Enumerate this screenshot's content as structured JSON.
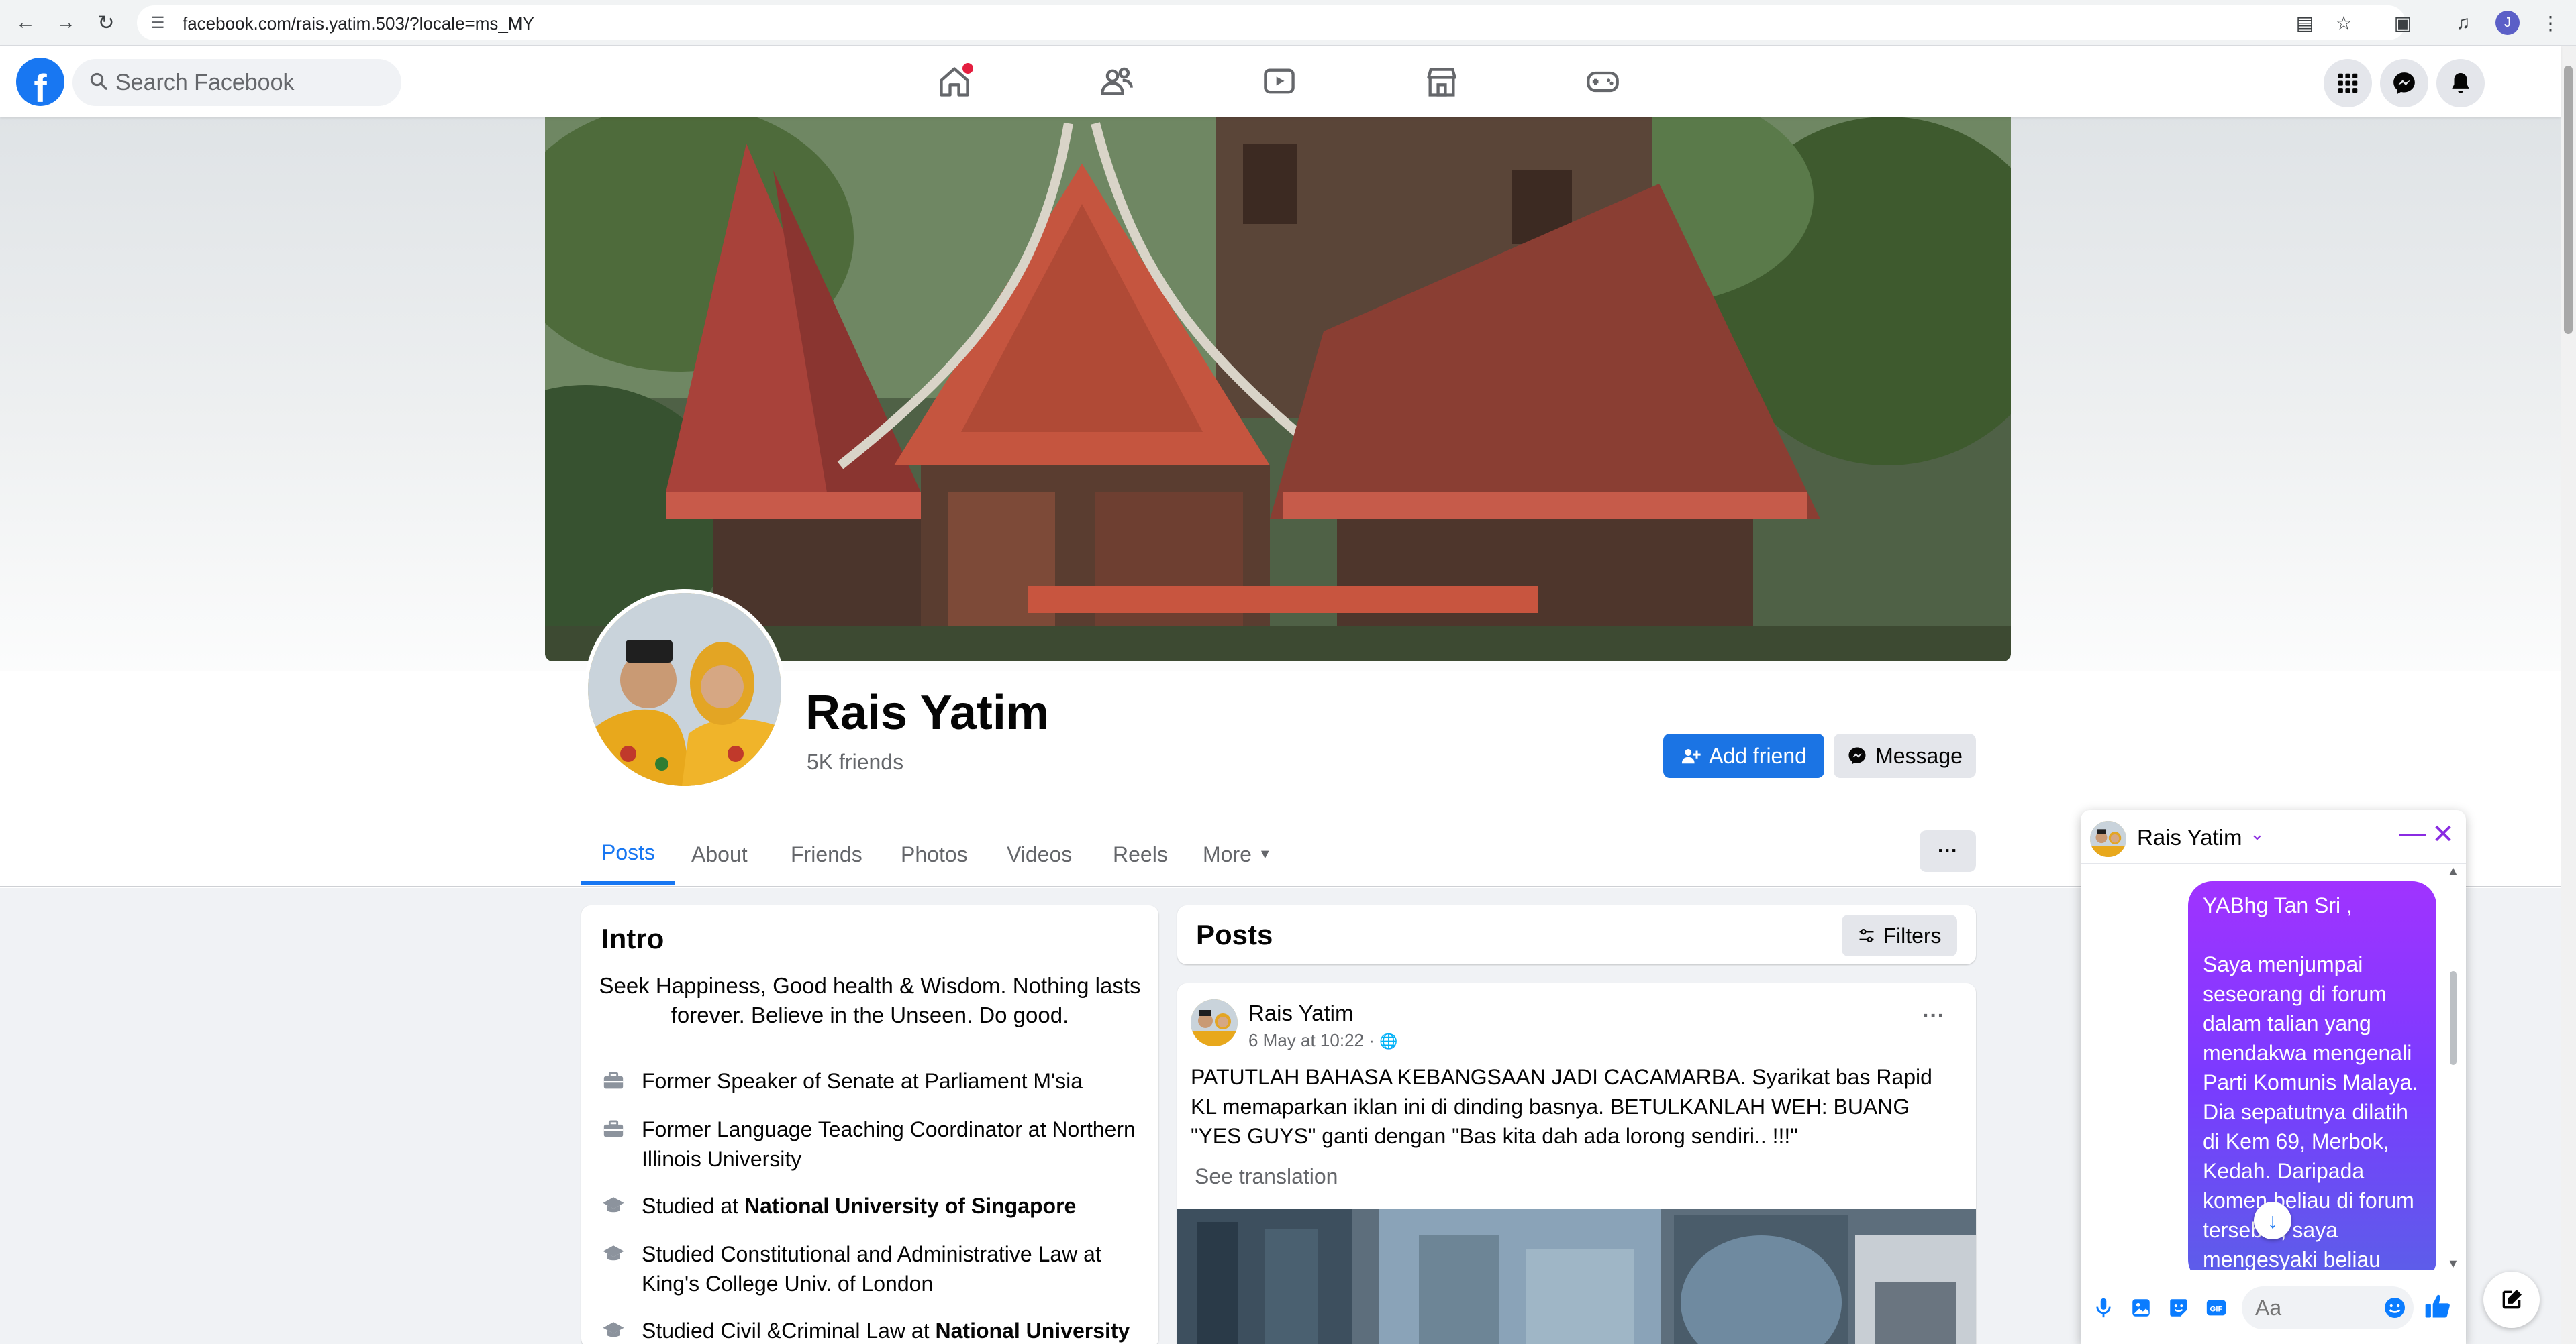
{
  "browser": {
    "url": "facebook.com/rais.yatim.503/?locale=ms_MY",
    "profile_initial": "J"
  },
  "nav": {
    "logo": "f",
    "search_placeholder": "Search Facebook",
    "tabs": [
      "home-icon",
      "friends-icon",
      "watch-icon",
      "marketplace-icon",
      "gaming-icon"
    ],
    "right_icons": [
      "menu-grid-icon",
      "messenger-icon",
      "bell-icon"
    ]
  },
  "profile": {
    "name": "Rais Yatim",
    "friends": "5K friends",
    "add_friend": "Add friend",
    "message": "Message",
    "tabs": [
      "Posts",
      "About",
      "Friends",
      "Photos",
      "Videos",
      "Reels",
      "More"
    ],
    "more_menu": "···"
  },
  "intro": {
    "title": "Intro",
    "bio": "Seek Happiness, Good health & Wisdom. Nothing lasts forever. Believe in the Unseen. Do good.",
    "items": [
      {
        "text": "Former Speaker of Senate at Parliament M'sia",
        "bold": ""
      },
      {
        "text": "Former Language Teaching Coordinator at Northern Illinois University",
        "bold": ""
      },
      {
        "text": "Studied at ",
        "bold": "National University of Singapore"
      },
      {
        "text": "Studied Constitutional and Administrative Law at King's College Univ. of London",
        "bold": ""
      },
      {
        "text": "Studied Civil &Criminal Law at ",
        "bold": "National University"
      }
    ]
  },
  "posts": {
    "title": "Posts",
    "filters": "Filters",
    "post": {
      "author": "Rais Yatim",
      "time": "6 May at 10:22 · ",
      "menu": "···",
      "text": "PATUTLAH BAHASA KEBANGSAAN JADI CACAMARBA. Syarikat bas Rapid KL memaparkan iklan ini di dinding basnya. BETULKANLAH WEH: BUANG \"YES GUYS\" ganti dengan \"Bas kita dah ada lorong sendiri.. !!!\"",
      "see_translation": "See translation"
    }
  },
  "chat": {
    "name": "Rais Yatim",
    "bubble": "YABhg Tan Sri ,\n\nSaya menjumpai seseorang di forum dalam talian yang mendakwa mengenali Parti Komunis Malaya. Dia sepatutnya dilatih di Kem 69, Merbok, Kedah. Daripada komen beliau di forum tersebut, saya mengesyaki beliau",
    "input_placeholder": "Aa"
  },
  "colors": {
    "fb_blue": "#1877f2",
    "messenger_purple": "#8a2be2",
    "bg": "#f0f2f5"
  }
}
